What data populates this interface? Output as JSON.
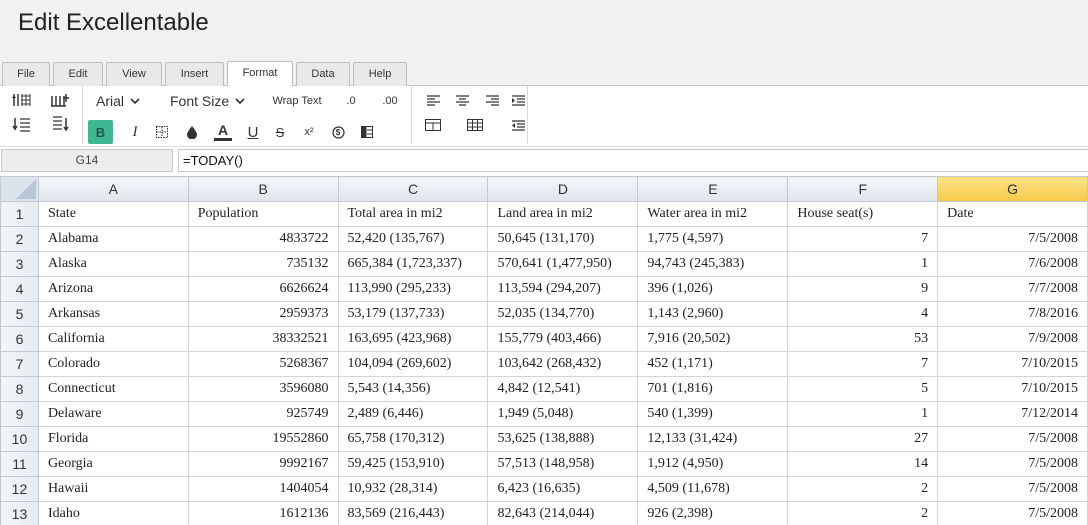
{
  "app": {
    "title": "Edit Excellentable"
  },
  "tabs": [
    {
      "label": "File"
    },
    {
      "label": "Edit"
    },
    {
      "label": "View"
    },
    {
      "label": "Insert"
    },
    {
      "label": "Format",
      "active": true
    },
    {
      "label": "Data"
    },
    {
      "label": "Help"
    }
  ],
  "toolbar": {
    "font_family": "Arial",
    "font_size": "Font Size",
    "wrap_text": "Wrap Text",
    "decimal_decrease": ".0",
    "decimal_increase": ".00",
    "bold": "B",
    "italic": "I",
    "font_color": "A",
    "underline": "U",
    "strike": "S",
    "superscript": "x²",
    "currency": "$",
    "accent_color": "#3fb793"
  },
  "formula_bar": {
    "cell_ref": "G14",
    "formula": "=TODAY()"
  },
  "grid": {
    "columns": [
      "A",
      "B",
      "C",
      "D",
      "E",
      "F",
      "G"
    ],
    "active_column": "G",
    "rows": [
      {
        "n": "1",
        "cells": [
          "State",
          "Population",
          "Total area in mi2",
          "Land area in mi2",
          "Water area in mi2",
          "House seat(s)",
          "Date"
        ]
      },
      {
        "n": "2",
        "cells": [
          "Alabama",
          "4833722",
          "52,420 (135,767)",
          "50,645 (131,170)",
          "1,775 (4,597)",
          "7",
          "7/5/2008"
        ]
      },
      {
        "n": "3",
        "cells": [
          "Alaska",
          "735132",
          "665,384 (1,723,337)",
          "570,641 (1,477,950)",
          "94,743 (245,383)",
          "1",
          "7/6/2008"
        ]
      },
      {
        "n": "4",
        "cells": [
          "Arizona",
          "6626624",
          "113,990 (295,233)",
          "113,594 (294,207)",
          "396 (1,026)",
          "9",
          "7/7/2008"
        ]
      },
      {
        "n": "5",
        "cells": [
          "Arkansas",
          "2959373",
          "53,179 (137,733)",
          "52,035 (134,770)",
          "1,143 (2,960)",
          "4",
          "7/8/2016"
        ]
      },
      {
        "n": "6",
        "cells": [
          "California",
          "38332521",
          "163,695 (423,968)",
          "155,779 (403,466)",
          "7,916 (20,502)",
          "53",
          "7/9/2008"
        ]
      },
      {
        "n": "7",
        "cells": [
          "Colorado",
          "5268367",
          "104,094 (269,602)",
          "103,642 (268,432)",
          "452 (1,171)",
          "7",
          "7/10/2015"
        ]
      },
      {
        "n": "8",
        "cells": [
          "Connecticut",
          "3596080",
          "5,543 (14,356)",
          "4,842 (12,541)",
          "701 (1,816)",
          "5",
          "7/10/2015"
        ]
      },
      {
        "n": "9",
        "cells": [
          "Delaware",
          "925749",
          "2,489 (6,446)",
          "1,949 (5,048)",
          "540 (1,399)",
          "1",
          "7/12/2014"
        ]
      },
      {
        "n": "10",
        "cells": [
          "Florida",
          "19552860",
          "65,758 (170,312)",
          "53,625 (138,888)",
          "12,133 (31,424)",
          "27",
          "7/5/2008"
        ]
      },
      {
        "n": "11",
        "cells": [
          "Georgia",
          "9992167",
          "59,425 (153,910)",
          "57,513 (148,958)",
          "1,912 (4,950)",
          "14",
          "7/5/2008"
        ]
      },
      {
        "n": "12",
        "cells": [
          "Hawaii",
          "1404054",
          "10,932 (28,314)",
          "6,423 (16,635)",
          "4,509 (11,678)",
          "2",
          "7/5/2008"
        ]
      },
      {
        "n": "13",
        "cells": [
          "Idaho",
          "1612136",
          "83,569 (216,443)",
          "82,643 (214,044)",
          "926 (2,398)",
          "2",
          "7/5/2008"
        ]
      }
    ]
  }
}
